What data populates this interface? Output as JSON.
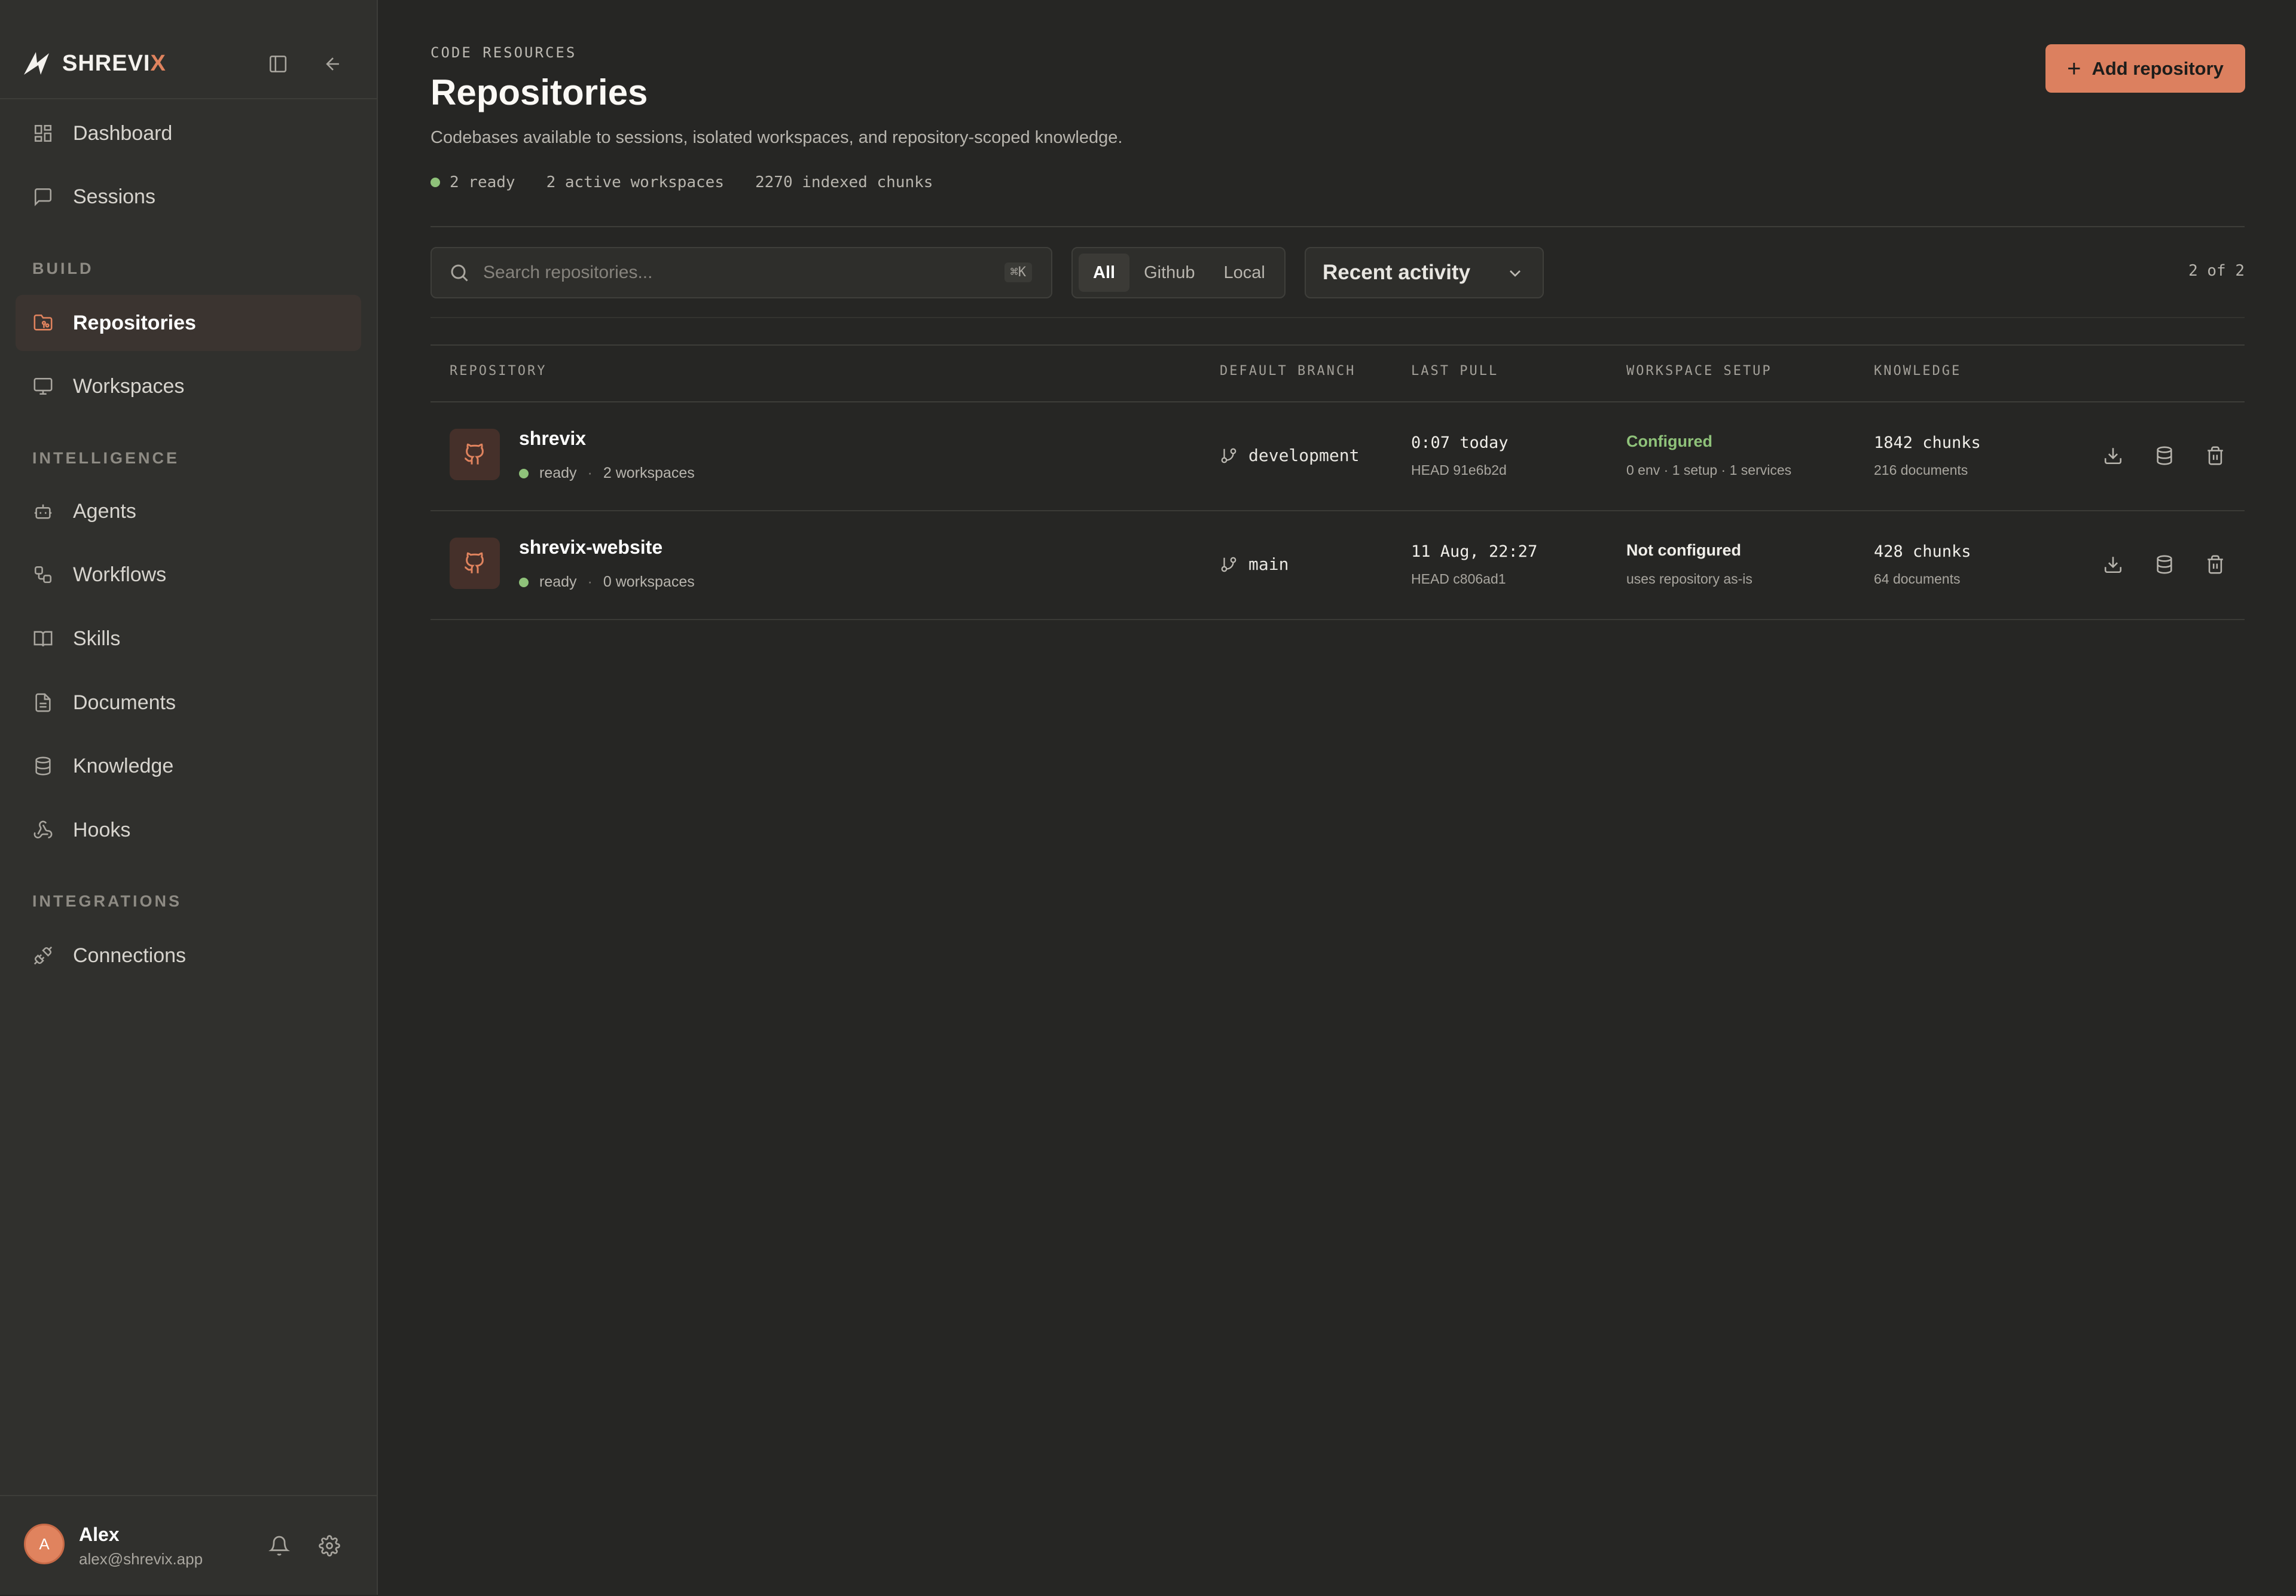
{
  "brand": {
    "name_main": "SHREVI",
    "name_accent": "X"
  },
  "sidebar": {
    "nav_top": [
      {
        "label": "Dashboard",
        "icon": "dashboard-icon"
      },
      {
        "label": "Sessions",
        "icon": "chat-icon"
      }
    ],
    "sections": [
      {
        "title": "BUILD",
        "items": [
          {
            "label": "Repositories",
            "icon": "folder-git-icon",
            "active": true
          },
          {
            "label": "Workspaces",
            "icon": "monitor-icon"
          }
        ]
      },
      {
        "title": "INTELLIGENCE",
        "items": [
          {
            "label": "Agents",
            "icon": "bot-icon"
          },
          {
            "label": "Workflows",
            "icon": "workflow-icon"
          },
          {
            "label": "Skills",
            "icon": "book-icon"
          },
          {
            "label": "Documents",
            "icon": "file-icon"
          },
          {
            "label": "Knowledge",
            "icon": "database-icon"
          },
          {
            "label": "Hooks",
            "icon": "webhook-icon"
          }
        ]
      },
      {
        "title": "INTEGRATIONS",
        "items": [
          {
            "label": "Connections",
            "icon": "plug-icon"
          }
        ]
      }
    ],
    "user": {
      "initial": "A",
      "name": "Alex",
      "email": "alex@shrevix.app"
    }
  },
  "header": {
    "eyebrow": "CODE RESOURCES",
    "title": "Repositories",
    "subtitle": "Codebases available to sessions, isolated workspaces, and repository-scoped knowledge.",
    "stats": {
      "ready": "2 ready",
      "workspaces": "2 active workspaces",
      "chunks": "2270 indexed chunks"
    },
    "add_button": "Add repository"
  },
  "toolbar": {
    "search_placeholder": "Search repositories...",
    "shortcut": "⌘K",
    "filters": [
      "All",
      "Github",
      "Local"
    ],
    "active_filter": "All",
    "sort_label": "Recent activity",
    "count": "2 of 2"
  },
  "table": {
    "columns": [
      "REPOSITORY",
      "DEFAULT BRANCH",
      "LAST PULL",
      "WORKSPACE SETUP",
      "KNOWLEDGE"
    ],
    "rows": [
      {
        "name": "shrevix",
        "status": "ready",
        "workspaces": "2 workspaces",
        "branch": "development",
        "last_pull": "0:07 today",
        "head": "HEAD 91e6b2d",
        "ws_status": "Configured",
        "ws_status_color": "#8fc27a",
        "ws_detail": "0 env · 1 setup · 1 services",
        "chunks": "1842 chunks",
        "docs": "216 documents"
      },
      {
        "name": "shrevix-website",
        "status": "ready",
        "workspaces": "0 workspaces",
        "branch": "main",
        "last_pull": "11 Aug, 22:27",
        "head": "HEAD c806ad1",
        "ws_status": "Not configured",
        "ws_status_color": "#f0eee9",
        "ws_detail": "uses repository as-is",
        "chunks": "428 chunks",
        "docs": "64 documents"
      }
    ]
  },
  "colors": {
    "accent": "#dc805f",
    "ready": "#8fc27a",
    "background": "#262624",
    "sidebar": "#30302d"
  }
}
